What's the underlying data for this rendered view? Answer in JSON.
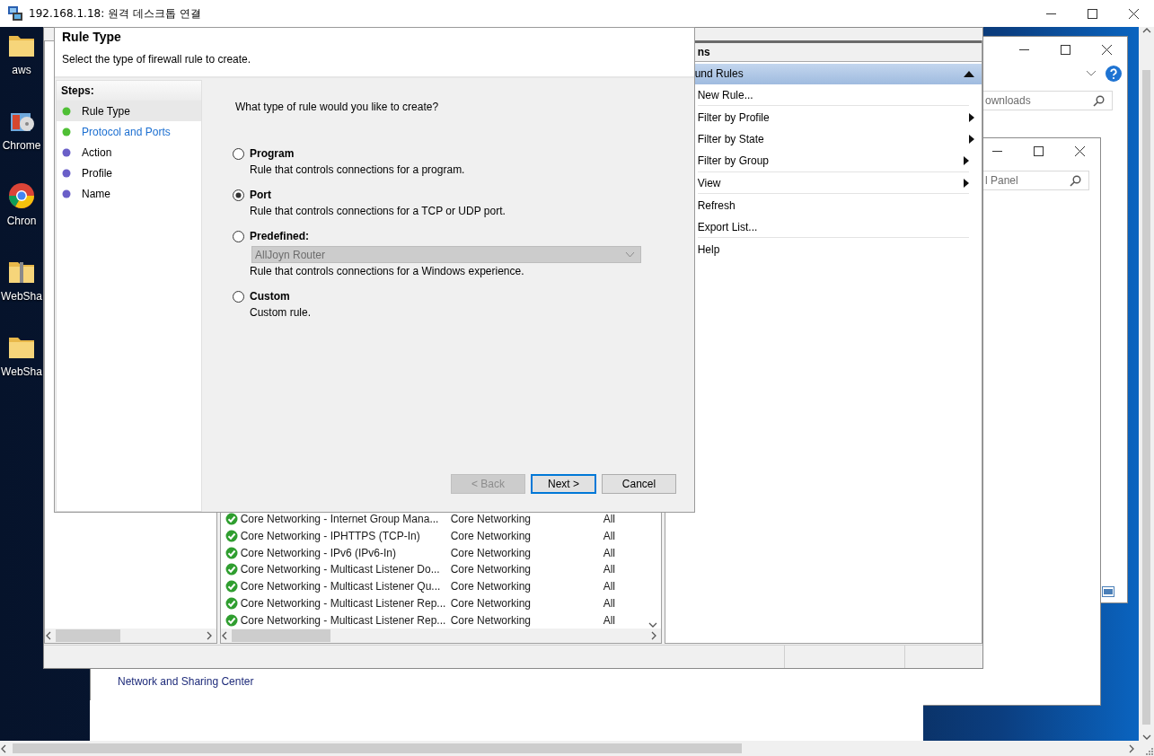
{
  "remote_window": {
    "title": "192.168.1.18: 원격 데스크톱 연결"
  },
  "desktop_icons": [
    {
      "label": "aws",
      "kind": "folder"
    },
    {
      "label": "Chrome",
      "kind": "installer"
    },
    {
      "label": "Chron",
      "kind": "browser"
    },
    {
      "label": "WebSha",
      "kind": "zip"
    },
    {
      "label": "WebSha",
      "kind": "folder"
    }
  ],
  "downloads_window": {
    "search": {
      "placeholder": "ownloads"
    }
  },
  "control_panel_window": {
    "search": {
      "placeholder": "l Panel"
    },
    "links": [
      "Network and Sharing Center"
    ]
  },
  "firewall_console": {
    "actions": {
      "header": "ns",
      "group": {
        "title": "und Rules",
        "expanded": true
      },
      "items": [
        {
          "label": "New Rule...",
          "submenu": false,
          "divider": true
        },
        {
          "label": "Filter by Profile",
          "submenu": true,
          "divider": false
        },
        {
          "label": "Filter by State",
          "submenu": true,
          "divider": false
        },
        {
          "label": "Filter by Group",
          "submenu": true,
          "divider": true
        },
        {
          "label": "View",
          "submenu": true,
          "divider": true
        },
        {
          "label": "Refresh",
          "submenu": false,
          "divider": false
        },
        {
          "label": "Export List...",
          "submenu": false,
          "divider": true
        },
        {
          "label": "Help",
          "submenu": false,
          "divider": false
        }
      ]
    },
    "rules_table": {
      "rows": [
        {
          "name": "Core Networking - Internet Group Mana...",
          "group": "Core Networking",
          "profile": "All",
          "enabled": true
        },
        {
          "name": "Core Networking - IPHTTPS (TCP-In)",
          "group": "Core Networking",
          "profile": "All",
          "enabled": true
        },
        {
          "name": "Core Networking - IPv6 (IPv6-In)",
          "group": "Core Networking",
          "profile": "All",
          "enabled": true
        },
        {
          "name": "Core Networking - Multicast Listener Do...",
          "group": "Core Networking",
          "profile": "All",
          "enabled": true
        },
        {
          "name": "Core Networking - Multicast Listener Qu...",
          "group": "Core Networking",
          "profile": "All",
          "enabled": true
        },
        {
          "name": "Core Networking - Multicast Listener Rep...",
          "group": "Core Networking",
          "profile": "All",
          "enabled": true
        },
        {
          "name": "Core Networking - Multicast Listener Rep...",
          "group": "Core Networking",
          "profile": "All",
          "enabled": true
        }
      ]
    }
  },
  "wizard": {
    "title": "Rule Type",
    "subtitle": "Select the type of firewall rule to create.",
    "steps_heading": "Steps:",
    "steps": [
      {
        "label": "Rule Type",
        "selected": true,
        "link": false,
        "color": "#4fbf35"
      },
      {
        "label": "Protocol and Ports",
        "selected": false,
        "link": true,
        "color": "#4fbf35"
      },
      {
        "label": "Action",
        "selected": false,
        "link": false,
        "color": "#6a5fc8"
      },
      {
        "label": "Profile",
        "selected": false,
        "link": false,
        "color": "#6a5fc8"
      },
      {
        "label": "Name",
        "selected": false,
        "link": false,
        "color": "#6a5fc8"
      }
    ],
    "question": "What type of rule would you like to create?",
    "options": [
      {
        "label": "Program",
        "description": "Rule that controls connections for a program.",
        "selected": false
      },
      {
        "label": "Port",
        "description": "Rule that controls connections for a TCP or UDP port.",
        "selected": true
      },
      {
        "label": "Predefined:",
        "description": "Rule that controls connections for a Windows experience.",
        "selected": false,
        "dropdown": {
          "value": "AllJoyn Router",
          "disabled": true
        }
      },
      {
        "label": "Custom",
        "description": "Custom rule.",
        "selected": false
      }
    ],
    "buttons": [
      {
        "label": "< Back",
        "disabled": true,
        "focused": false
      },
      {
        "label": "Next >",
        "disabled": false,
        "focused": true
      },
      {
        "label": "Cancel",
        "disabled": false,
        "focused": false
      }
    ]
  }
}
